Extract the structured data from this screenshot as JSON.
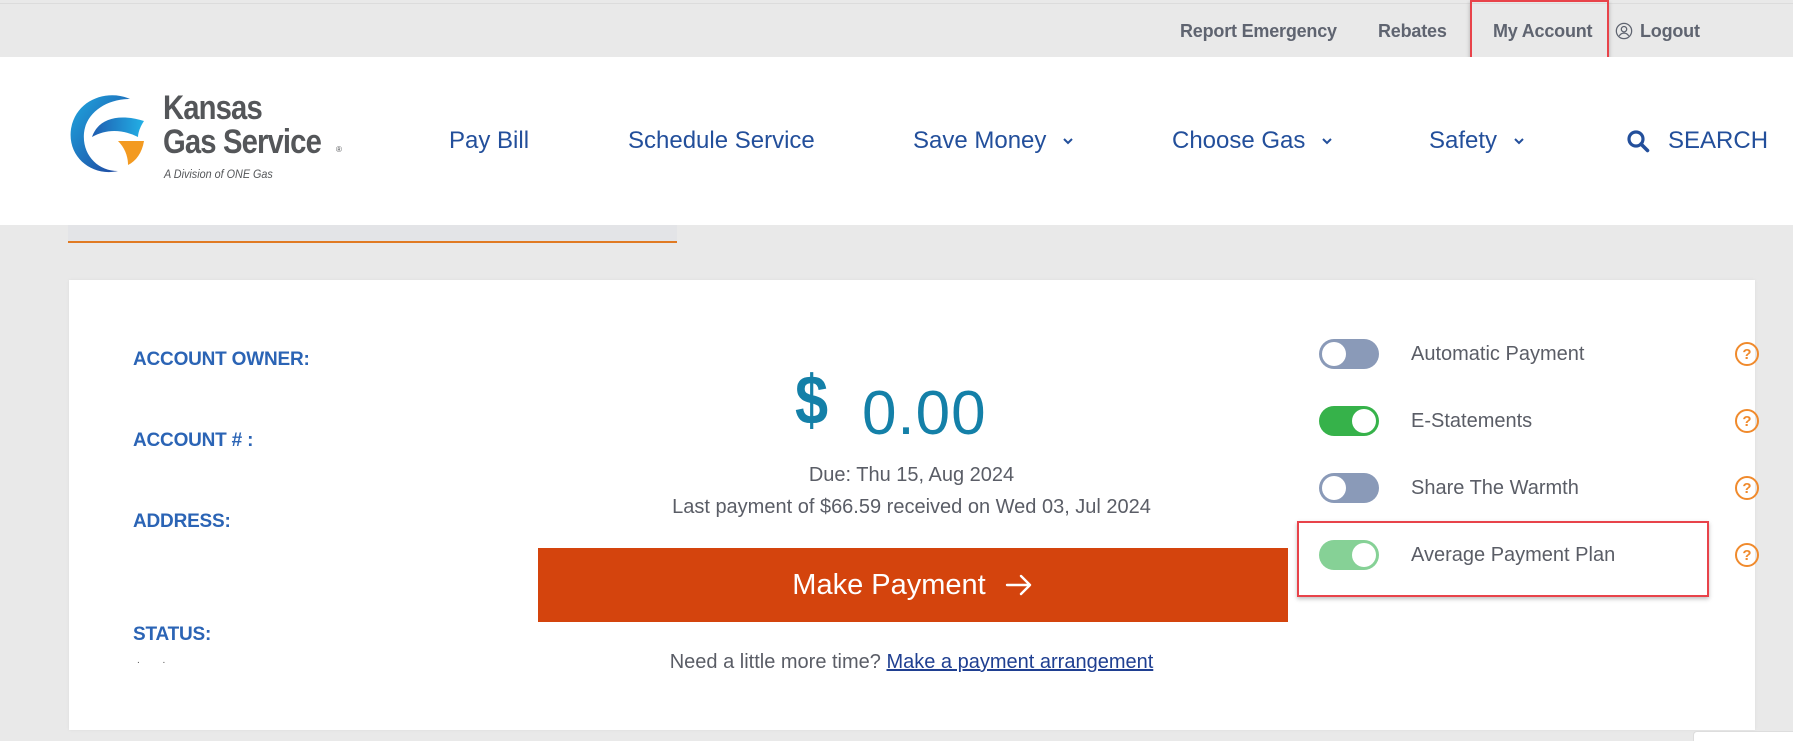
{
  "topbar": {
    "links": [
      {
        "label": "Report Emergency"
      },
      {
        "label": "Rebates"
      },
      {
        "label": "My Account"
      },
      {
        "label": "Logout",
        "icon": "user-circle-icon"
      }
    ]
  },
  "header": {
    "logo": {
      "line1": "Kansas",
      "line2": "Gas Service",
      "reg": "®",
      "subtitle": "A Division of ONE Gas"
    },
    "nav": [
      {
        "label": "Pay Bill"
      },
      {
        "label": "Schedule Service"
      },
      {
        "label": "Save Money",
        "icon": "chevron-down-icon"
      },
      {
        "label": "Choose Gas",
        "icon": "chevron-down-icon"
      },
      {
        "label": "Safety",
        "icon": "chevron-down-icon"
      }
    ],
    "search_label": "SEARCH"
  },
  "account": {
    "labels": {
      "owner": "ACCOUNT OWNER:",
      "number": "ACCOUNT # :",
      "address": "ADDRESS:",
      "status": "STATUS:"
    },
    "currency_symbol": "$",
    "amount_due": "0.00",
    "due_text": "Due: Thu 15, Aug 2024",
    "last_payment_text": "Last payment of $66.59 received on Wed 03, Jul 2024",
    "make_payment_label": "Make Payment",
    "more_time_text": "Need a little more time?",
    "arrangement_link": "Make a payment arrangement"
  },
  "settings": [
    {
      "label": "Automatic Payment",
      "enabled": false
    },
    {
      "label": "E-Statements",
      "enabled": true
    },
    {
      "label": "Share The Warmth",
      "enabled": false
    },
    {
      "label": "Average Payment Plan",
      "enabled": true
    }
  ],
  "help_glyph": "?",
  "colors": {
    "brand_blue": "#234f9b",
    "label_blue": "#2b64b5",
    "amount_teal": "#1480a8",
    "pay_button": "#d4440d",
    "toggle_on": "#36b24a",
    "toggle_off": "#8a9ab8",
    "help_orange": "#f08a2c",
    "highlight_red": "#e8434a"
  }
}
